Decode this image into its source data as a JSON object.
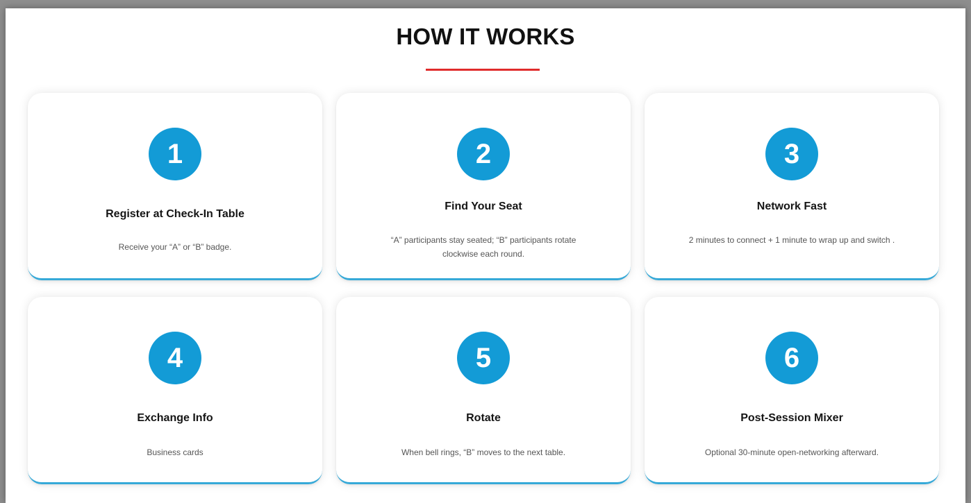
{
  "section": {
    "title": "HOW IT WORKS",
    "accent_color": "#e02b2b",
    "badge_color": "#139bd6",
    "card_border_color": "#36a9d8"
  },
  "steps": [
    {
      "number": "1",
      "title": "Register at Check-In Table",
      "description": "Receive your “A” or “B” badge."
    },
    {
      "number": "2",
      "title": "Find Your Seat",
      "description": "“A” participants stay seated; “B” participants rotate clockwise each round."
    },
    {
      "number": "3",
      "title": "Network Fast",
      "description": "2 minutes to connect + 1 minute to wrap up and switch ."
    },
    {
      "number": "4",
      "title": "Exchange Info",
      "description": "Business cards"
    },
    {
      "number": "5",
      "title": "Rotate",
      "description": "When bell rings, “B” moves to the next table."
    },
    {
      "number": "6",
      "title": "Post-Session Mixer",
      "description": "Optional 30-minute open-networking afterward."
    }
  ]
}
